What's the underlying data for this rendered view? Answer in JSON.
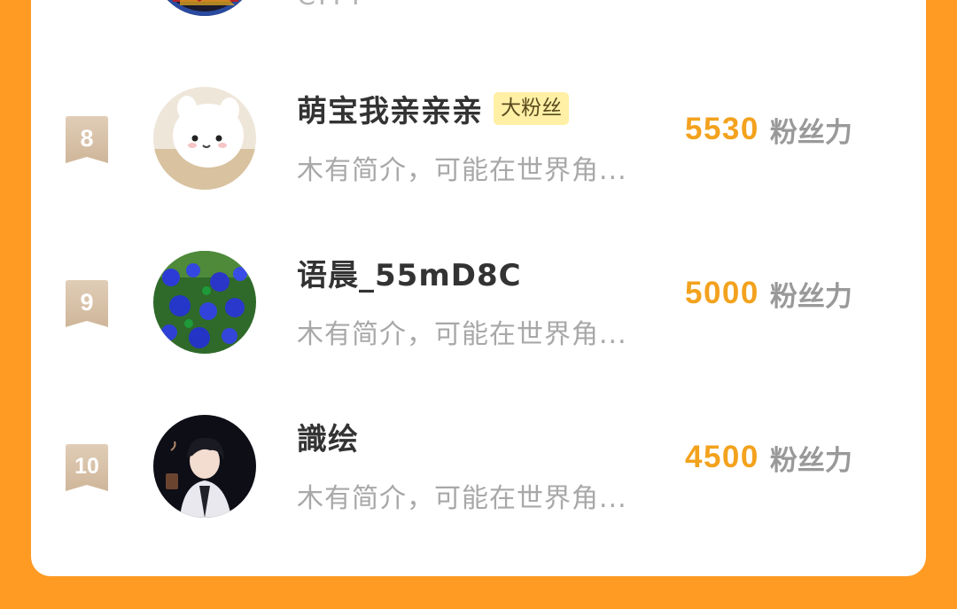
{
  "partial_row": {
    "bio": "CITY"
  },
  "ranking": [
    {
      "rank": "8",
      "name": "萌宝我亲亲亲",
      "tag": "大粉丝",
      "bio": "木有简介，可能在世界角...",
      "score": "5530",
      "score_label": "粉丝力"
    },
    {
      "rank": "9",
      "name": "语晨_55mD8C",
      "tag": "",
      "bio": "木有简介，可能在世界角...",
      "score": "5000",
      "score_label": "粉丝力"
    },
    {
      "rank": "10",
      "name": "識绘",
      "tag": "",
      "bio": "木有简介，可能在世界角...",
      "score": "4500",
      "score_label": "粉丝力"
    }
  ],
  "colors": {
    "background": "#FF9A22",
    "score": "#F3A21E",
    "badge": "#D8C3AA",
    "tag_bg": "#FFF0A6"
  }
}
